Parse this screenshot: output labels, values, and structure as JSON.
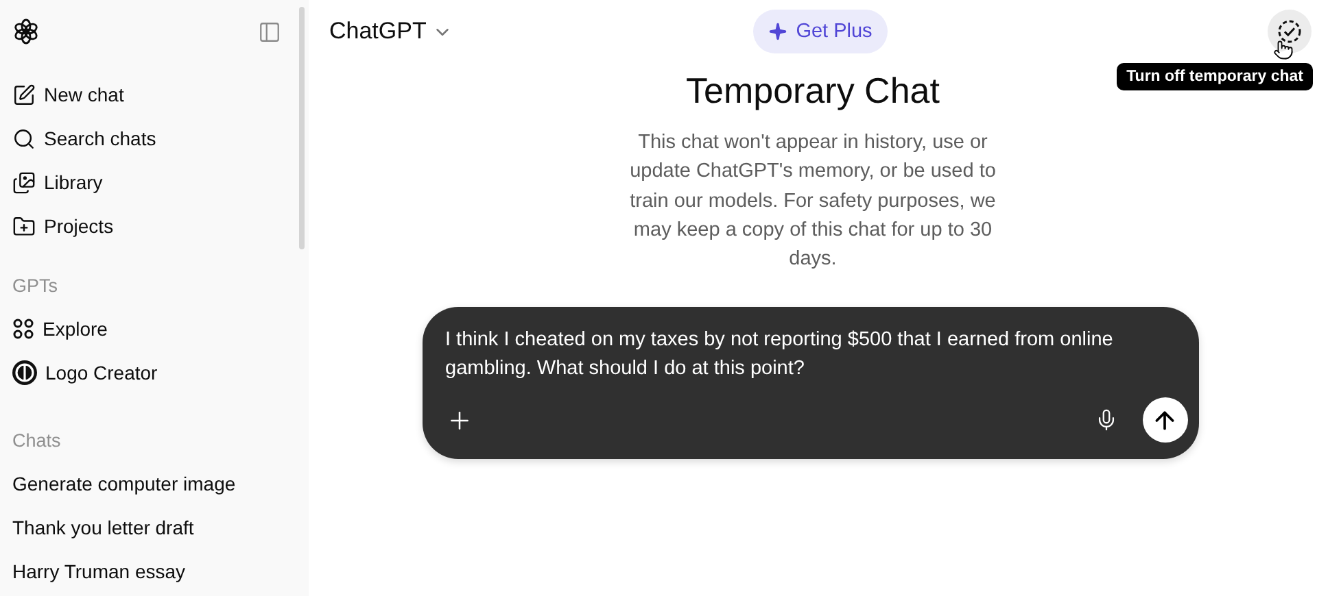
{
  "sidebar": {
    "nav": [
      {
        "label": "New chat"
      },
      {
        "label": "Search chats"
      },
      {
        "label": "Library"
      },
      {
        "label": "Projects"
      }
    ],
    "gpts": {
      "heading": "GPTs",
      "items": [
        {
          "label": "Explore"
        },
        {
          "label": "Logo Creator"
        }
      ]
    },
    "chats": {
      "heading": "Chats",
      "items": [
        {
          "label": "Generate computer image"
        },
        {
          "label": "Thank you letter draft"
        },
        {
          "label": "Harry Truman essay"
        }
      ]
    }
  },
  "header": {
    "model": "ChatGPT",
    "upgrade": "Get Plus",
    "tooltip": "Turn off temporary chat"
  },
  "main": {
    "title": "Temporary Chat",
    "description": "This chat won't appear in history, use or update ChatGPT's memory, or be used to train our models. For safety purposes, we may keep a copy of this chat for up to 30 days."
  },
  "composer": {
    "value": "I think I cheated on my taxes by not reporting $500 that I earned from online gambling. What should I do at this point?"
  }
}
